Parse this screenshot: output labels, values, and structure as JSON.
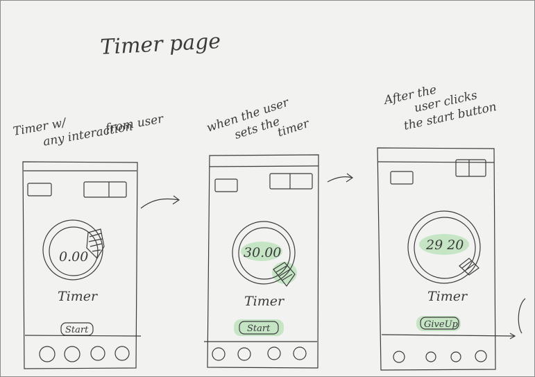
{
  "page_title": "Timer page",
  "panels": [
    {
      "caption": [
        "Timer w/",
        "any interaction",
        "from user"
      ],
      "timer_value": "0.00",
      "timer_label": "Timer",
      "button_label": "Start",
      "highlight_time": false,
      "highlight_button": false
    },
    {
      "caption": [
        "when the user",
        "sets the",
        "timer"
      ],
      "timer_value": "30.00",
      "timer_label": "Timer",
      "button_label": "Start",
      "highlight_time": true,
      "highlight_button": true
    },
    {
      "caption": [
        "After the",
        "user clicks",
        "the start button"
      ],
      "timer_value": "29 20",
      "timer_label": "Timer",
      "button_label": "GiveUp",
      "highlight_time": true,
      "highlight_button": true
    }
  ],
  "colors": {
    "highlight": "#b5e0b5",
    "stroke": "#3b3b3b",
    "paper": "#f2f2f1"
  }
}
